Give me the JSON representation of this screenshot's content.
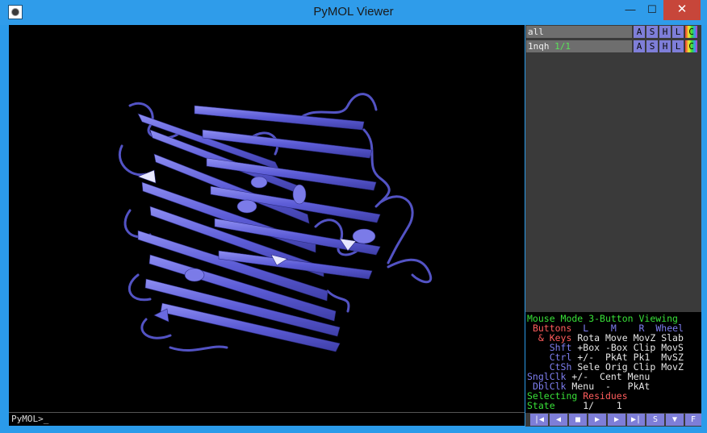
{
  "window": {
    "title": "PyMOL Viewer",
    "minimize": "—",
    "maximize": "☐",
    "close": "✕"
  },
  "command_line": {
    "prompt": "PyMOL>_"
  },
  "objects": [
    {
      "name": "all",
      "state": ""
    },
    {
      "name": "1nqh",
      "state": "1/1"
    }
  ],
  "object_buttons": [
    "A",
    "S",
    "H",
    "L",
    "C"
  ],
  "mouse_panel": {
    "header_label": "Mouse Mode",
    "header_mode": "3-Button Viewing",
    "buttons_label": "Buttons",
    "col_L": "L",
    "col_M": "M",
    "col_R": "R",
    "col_Wheel": "Wheel",
    "rows": [
      {
        "label": "& Keys",
        "values": "Rota Move MovZ Slab"
      },
      {
        "label": "Shft",
        "values": "+Box -Box Clip MovS"
      },
      {
        "label": "Ctrl",
        "values": "+/-  PkAt Pk1  MvSZ"
      },
      {
        "label": "CtSh",
        "values": "Sele Orig Clip MovZ"
      },
      {
        "label": "SnglClk",
        "values": "+/-  Cent Menu"
      },
      {
        "label": "DblClk",
        "values": "Menu  -   PkAt"
      }
    ],
    "selecting_label": "Selecting",
    "selecting_value": "Residues",
    "state_label": "State",
    "state_value": "1/    1"
  },
  "playback": {
    "rewind": "|◀",
    "back": "◀",
    "stop": "■",
    "play": "▶",
    "forward": "▶",
    "end": "▶|",
    "scene": "S",
    "menu": "▼",
    "full": "F"
  },
  "colors": {
    "ribbon": "#5c5cd6",
    "ribbon_light": "#9a9af0",
    "button": "#7e7ed8"
  }
}
